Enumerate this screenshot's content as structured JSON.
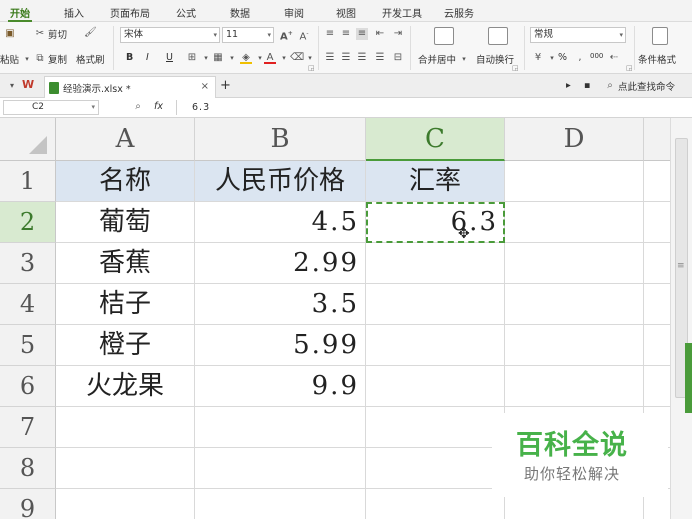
{
  "menu": {
    "tabs": [
      "开始",
      "插入",
      "页面布局",
      "公式",
      "数据",
      "审阅",
      "视图",
      "开发工具",
      "云服务"
    ]
  },
  "ribbon": {
    "paste": "粘贴",
    "cut": "剪切",
    "copy": "复制",
    "format_painter": "格式刷",
    "font_name": "宋体",
    "font_size": "11",
    "bold": "B",
    "italic": "I",
    "underline": "U",
    "merge_center": "合并居中",
    "wrap_text": "自动换行",
    "number_format": "常规",
    "conditional_format": "条件格式",
    "percent": "%",
    "comma": "000"
  },
  "tabbar": {
    "file_name": "经验演示.xlsx *",
    "close": "×",
    "add": "+",
    "search_placeholder": "点此查找命令"
  },
  "formula_bar": {
    "cell_ref": "C2",
    "fx": "fx",
    "value": "6.3"
  },
  "sheet": {
    "columns": [
      "A",
      "B",
      "C",
      "D"
    ],
    "selected_column": "C",
    "rows": [
      "1",
      "2",
      "3",
      "4",
      "5",
      "6",
      "7",
      "8",
      "9"
    ],
    "selected_row": "2",
    "headers": [
      "名称",
      "人民币价格",
      "汇率"
    ],
    "data": [
      {
        "name": "葡萄",
        "price": "4.5",
        "rate": "6.3"
      },
      {
        "name": "香蕉",
        "price": "2.99",
        "rate": ""
      },
      {
        "name": "桔子",
        "price": "3.5",
        "rate": ""
      },
      {
        "name": "橙子",
        "price": "5.99",
        "rate": ""
      },
      {
        "name": "火龙果",
        "price": "9.9",
        "rate": ""
      }
    ]
  },
  "watermark": {
    "title": "百科全说",
    "subtitle": "助你轻松解决"
  },
  "colors": {
    "accent_green": "#4a9b3a",
    "header_fill": "#dbe5f1",
    "watermark_green": "#47b24a"
  }
}
